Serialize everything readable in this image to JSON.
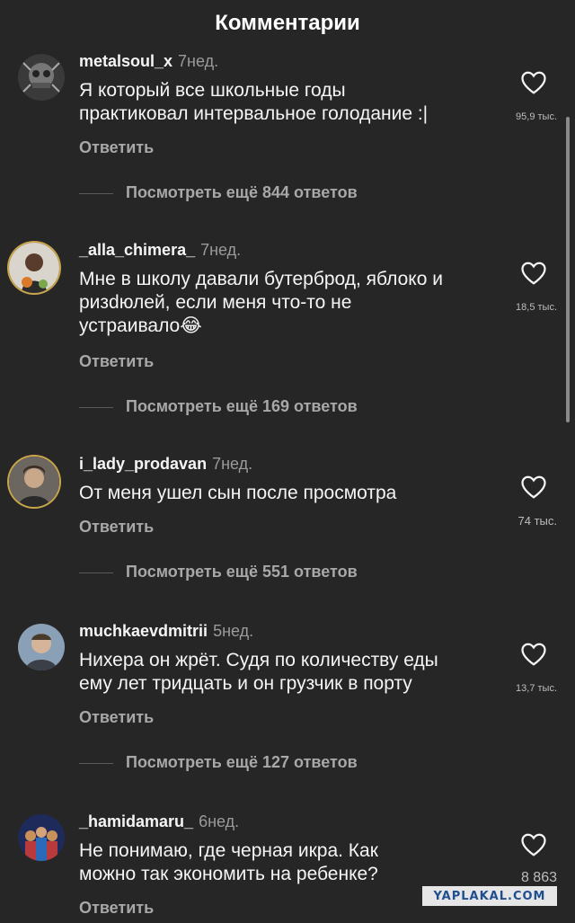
{
  "header": {
    "title": "Комментарии"
  },
  "comments": [
    {
      "author": "metalsoul_x",
      "time": "7нед.",
      "text": "Я который все школьные годы\nпрактиковал интервальное голодание :|",
      "reply_label": "Ответить",
      "likes": "95,9 тыс.",
      "more_replies": "Посмотреть ещё 844 ответов"
    },
    {
      "author": "_alla_chimera_",
      "time": "7нед.",
      "text": "Мне в школу давали бутерброд, яблоко и\npизdюлей, если меня что-то не\nустраивало😂",
      "reply_label": "Ответить",
      "likes": "18,5 тыс.",
      "more_replies": "Посмотреть ещё 169 ответов"
    },
    {
      "author": "i_lady_prodavan",
      "time": "7нед.",
      "text": "От меня ушел сын после просмотра",
      "reply_label": "Ответить",
      "likes": "74 тыс.",
      "more_replies": "Посмотреть ещё 551 ответов"
    },
    {
      "author": "muchkaevdmitrii",
      "time": "5нед.",
      "text": "Нихера он жрёт. Судя по количеству еды\nему лет тридцать и он грузчик в порту",
      "reply_label": "Ответить",
      "likes": "13,7 тыс.",
      "more_replies": "Посмотреть ещё 127 ответов"
    },
    {
      "author": "_hamidamaru_",
      "time": "6нед.",
      "text": "Не понимаю, где черная икра. Как\nможно так экономить на ребенке?",
      "reply_label": "Ответить",
      "likes": "8 863"
    }
  ],
  "watermark": "YAPLAKAL.COM",
  "colors": {
    "background": "#262626",
    "text": "#f5f5f5",
    "muted": "#a8a8a8"
  }
}
